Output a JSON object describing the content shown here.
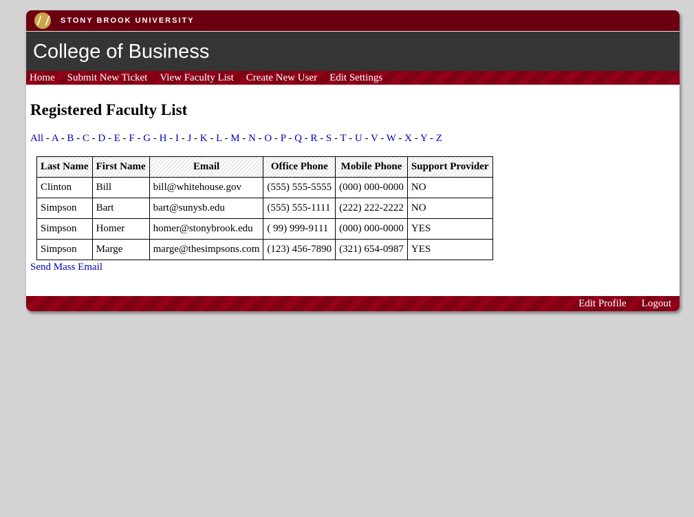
{
  "header": {
    "university": "STONY BROOK UNIVERSITY",
    "college": "College of Business"
  },
  "nav": {
    "items": [
      "Home",
      "Submit New Ticket",
      "View Faculty List",
      "Create New User",
      "Edit Settings"
    ]
  },
  "main": {
    "title": "Registered Faculty List",
    "alphabet": [
      "All",
      "A",
      "B",
      "C",
      "D",
      "E",
      "F",
      "G",
      "H",
      "I",
      "J",
      "K",
      "L",
      "M",
      "N",
      "O",
      "P",
      "Q",
      "R",
      "S",
      "T",
      "U",
      "V",
      "W",
      "X",
      "Y",
      "Z"
    ],
    "table": {
      "columns": [
        "Last Name",
        "First Name",
        "Email",
        "Office Phone",
        "Mobile Phone",
        "Support Provider"
      ],
      "rows": [
        [
          "Clinton",
          "Bill",
          "bill@whitehouse.gov",
          "(555) 555-5555",
          "(000) 000-0000",
          "NO"
        ],
        [
          "Simpson",
          "Bart",
          "bart@sunysb.edu",
          "(555) 555-1111",
          "(222) 222-2222",
          "NO"
        ],
        [
          "Simpson",
          "Homer",
          "homer@stonybrook.edu",
          "( 99) 999-9111",
          "(000) 000-0000",
          "YES"
        ],
        [
          "Simpson",
          "Marge",
          "marge@thesimpsons.com",
          "(123) 456-7890",
          "(321) 654-0987",
          "YES"
        ]
      ]
    },
    "mass_email_label": "Send Mass Email"
  },
  "footer": {
    "edit_profile": "Edit Profile",
    "logout": "Logout"
  }
}
